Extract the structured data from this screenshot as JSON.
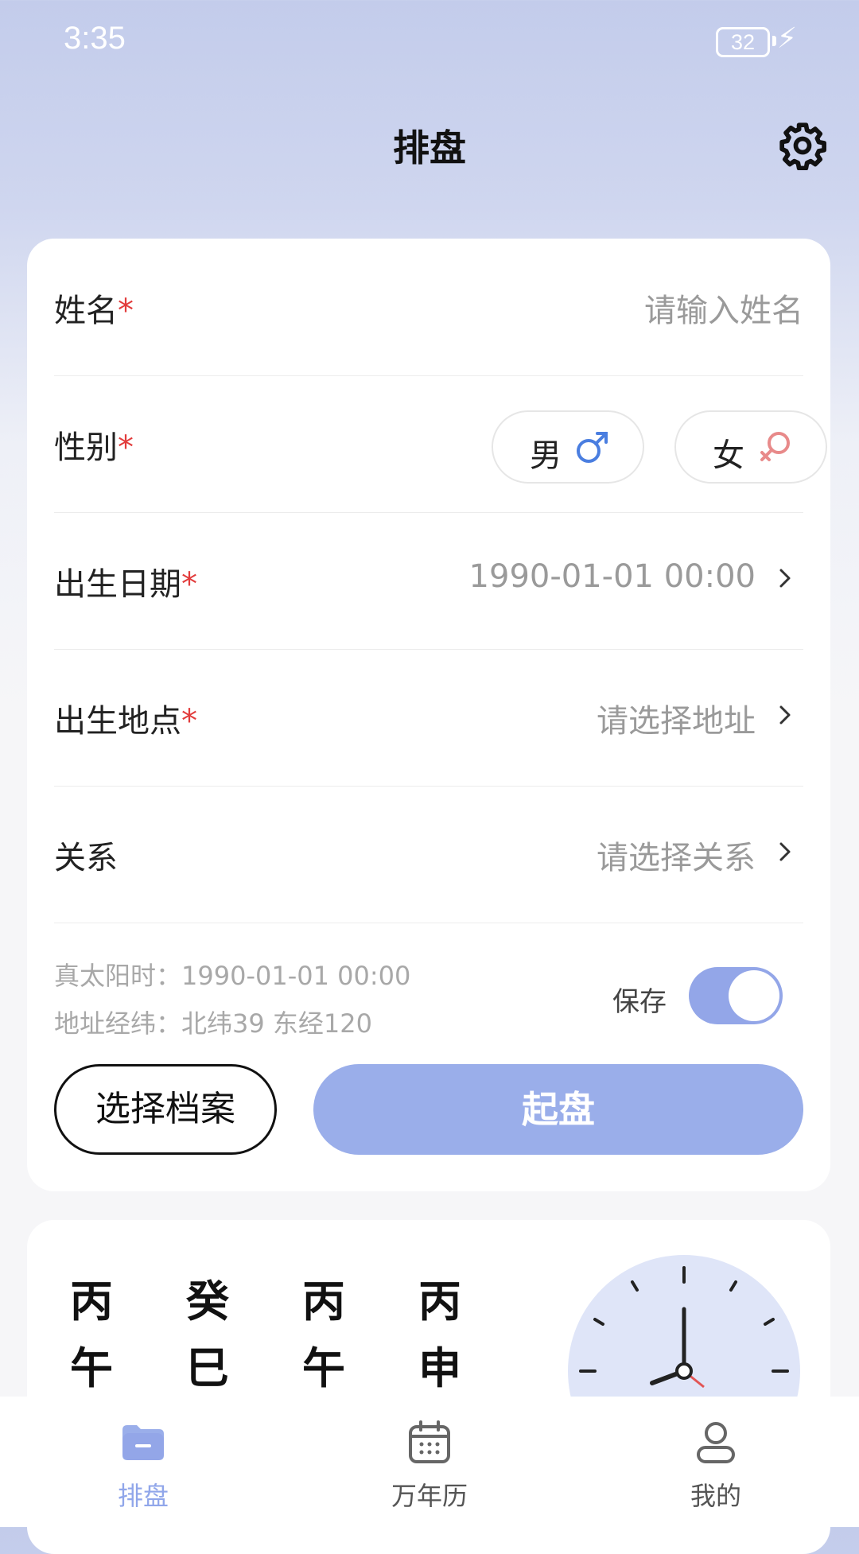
{
  "status_bar": {
    "time": "3:35",
    "battery": "32"
  },
  "header": {
    "title": "排盘"
  },
  "form": {
    "name": {
      "label": "姓名",
      "required": "*",
      "placeholder": "请输入姓名"
    },
    "gender": {
      "label": "性别",
      "required": "*",
      "male": "男",
      "female": "女"
    },
    "birth_date": {
      "label": "出生日期",
      "required": "*",
      "value": "1990-01-01 00:00"
    },
    "birth_place": {
      "label": "出生地点",
      "required": "*",
      "placeholder": "请选择地址"
    },
    "relation": {
      "label": "关系",
      "placeholder": "请选择关系"
    }
  },
  "info": {
    "solar_time": "真太阳时：1990-01-01 00:00",
    "coords": "地址经纬：北纬39  东经120"
  },
  "save": {
    "label": "保存",
    "enabled": true
  },
  "buttons": {
    "choose_archive": "选择档案",
    "start": "起盘"
  },
  "ganzhi": {
    "stems": [
      "丙",
      "癸",
      "丙",
      "丙"
    ],
    "branches": [
      "午",
      "巳",
      "午",
      "申"
    ]
  },
  "tabs": [
    {
      "label": "排盘",
      "icon": "folder-icon",
      "active": true
    },
    {
      "label": "万年历",
      "icon": "calendar-icon",
      "active": false
    },
    {
      "label": "我的",
      "icon": "user-icon",
      "active": false
    }
  ],
  "colors": {
    "accent": "#93a6e8",
    "required": "#e23c3c",
    "male": "#4a7ee0",
    "female": "#e88a8a"
  }
}
